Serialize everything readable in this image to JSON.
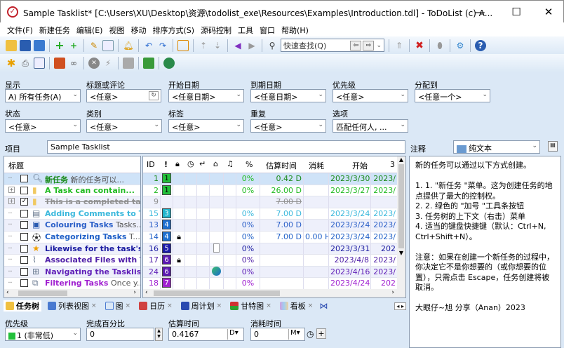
{
  "window": {
    "title": "Sample Tasklist* [C:\\Users\\XU\\Desktop\\资源\\todolist_exe\\Resources\\Examples\\Introduction.tdl] - ToDoList (c) A...",
    "minimize": "—",
    "maximize": "☐",
    "close": "✕"
  },
  "menu": [
    "文件(F)",
    "新建任务",
    "编辑(E)",
    "视图",
    "移动",
    "排序方式(S)",
    "源码控制",
    "工具",
    "窗口",
    "帮助(H)"
  ],
  "toolbar": {
    "quickfind_placeholder": "快速查找(Q)"
  },
  "filters": {
    "show": {
      "label": "显示",
      "value": "A)  所有任务(A)"
    },
    "title_comment": {
      "label": "标题或评论",
      "value": "<任意>"
    },
    "start_date": {
      "label": "开始日期",
      "value": "<任意日期>"
    },
    "due_date": {
      "label": "到期日期",
      "value": "<任意日期>"
    },
    "priority": {
      "label": "优先级",
      "value": "<任意>"
    },
    "assigned": {
      "label": "分配到",
      "value": "<任意一个>"
    },
    "status": {
      "label": "状态",
      "value": "<任意>"
    },
    "category": {
      "label": "类别",
      "value": "<任意>"
    },
    "tags": {
      "label": "标签",
      "value": "<任意>"
    },
    "recurrence": {
      "label": "重复",
      "value": "<任意>"
    },
    "options": {
      "label": "选项",
      "value": "匹配任何人, ..."
    }
  },
  "project": {
    "label": "项目",
    "value": "Sample Tasklist"
  },
  "columns": {
    "title": "标题",
    "id": "ID",
    "priority": "!",
    "percent": "%",
    "estimate": "估算时间",
    "spent": "消耗",
    "start": "开始",
    "due": "3"
  },
  "colors": {
    "selected_row": "#cfe3f8",
    "alt_row": "#eef0fb",
    "panel_bg": "#dbe8f6"
  },
  "tasks": [
    {
      "title": "新任务",
      "comment": "新的任务可以...",
      "id": "1",
      "priority": "1",
      "prio_color": "#22c03a",
      "color": "#1a8a1a",
      "icon": "search-icon",
      "percent": "0%",
      "estimate": "0.42 D",
      "spent": "",
      "start": "2023/3/30",
      "due": "2023/",
      "expand": false,
      "done": false,
      "lock": false,
      "selected": true
    },
    {
      "title": "A Task can contain...",
      "comment": "",
      "id": "2",
      "priority": "1",
      "prio_color": "#22c03a",
      "color": "#22bb22",
      "icon": "folder-icon",
      "percent": "0%",
      "estimate": "26.00 D",
      "spent": "",
      "start": "2023/3/27",
      "due": "2023/",
      "expand": true,
      "done": false
    },
    {
      "title": "This is a completed task",
      "comment": "",
      "id": "9",
      "priority": "",
      "prio_color": "",
      "color": "#909090",
      "icon": "folder-icon",
      "percent": "",
      "estimate": "7.00 D",
      "spent": "",
      "start": "",
      "due": "",
      "expand": true,
      "done": true
    },
    {
      "title": "Adding Comments to T...",
      "comment": "",
      "id": "15",
      "priority": "3",
      "prio_color": "#1fb4cc",
      "color": "#3ab8dc",
      "icon": "document-icon",
      "percent": "0%",
      "estimate": "7.00 D",
      "spent": "",
      "start": "2023/3/24",
      "due": "2023/"
    },
    {
      "title": "Colouring Tasks",
      "comment": "Tasks...",
      "id": "13",
      "priority": "4",
      "prio_color": "#1e6fd0",
      "color": "#2b5fc8",
      "icon": "monitor-icon",
      "percent": "0%",
      "estimate": "7.00 D",
      "spent": "",
      "start": "2023/3/24",
      "due": "2023/"
    },
    {
      "title": "Categorizing Tasks",
      "comment": "T...",
      "id": "14",
      "priority": "4",
      "prio_color": "#1e6fd0",
      "color": "#2060c8",
      "icon": "soccer-ball-icon",
      "percent": "0%",
      "estimate": "7.00 D",
      "spent": "0.00 H",
      "start": "2023/3/24",
      "due": "2023/",
      "lock": true
    },
    {
      "title": "Likewise for the task's ...",
      "comment": "",
      "id": "16",
      "priority": "5",
      "prio_color": "#1a1aa8",
      "color": "#1a1aa0",
      "icon": "star-icon",
      "percent": "0%",
      "estimate": "",
      "spent": "",
      "start": "2023/3/31",
      "due": "202",
      "file": "file-icon"
    },
    {
      "title": "Associated Files with T...",
      "comment": "",
      "id": "17",
      "priority": "6",
      "prio_color": "#5a18b0",
      "color": "#5020a8",
      "icon": "paperclip-icon",
      "percent": "0%",
      "estimate": "",
      "spent": "",
      "start": "2023/4/8",
      "due": "2023/",
      "lock": true
    },
    {
      "title": "Navigating the Tasklist",
      "comment": "",
      "id": "24",
      "priority": "6",
      "prio_color": "#5a18b0",
      "color": "#6020b8",
      "icon": "toolbox-icon",
      "percent": "0%",
      "estimate": "",
      "spent": "",
      "start": "2023/4/16",
      "due": "2023/",
      "file": "edge-browser-icon"
    },
    {
      "title": "Filtering Tasks",
      "comment": "Once y...",
      "id": "18",
      "priority": "7",
      "prio_color": "#a020d0",
      "color": "#a020d0",
      "icon": "filter-icon",
      "percent": "0%",
      "estimate": "",
      "spent": "",
      "start": "2023/4/24",
      "due": "202"
    }
  ],
  "tabs": [
    {
      "label": "任务树",
      "active": true
    },
    {
      "label": "列表视图"
    },
    {
      "label": "图"
    },
    {
      "label": "日历"
    },
    {
      "label": "周计划"
    },
    {
      "label": "甘特图"
    },
    {
      "label": "看板"
    }
  ],
  "details": {
    "priority": {
      "label": "优先级",
      "value": "1 (非常低)"
    },
    "percent": {
      "label": "完成百分比",
      "value": "0"
    },
    "estimate": {
      "label": "估算时间",
      "value": "0.4167",
      "unit": "D"
    },
    "spent": {
      "label": "消耗时间",
      "value": "0",
      "unit": "M"
    }
  },
  "notes": {
    "label": "注释",
    "format": "纯文本",
    "text": "新的任务可以通过以下方式创建。\n\n1. 1. \"新任务 \"菜单。这为创建任务的地点提供了最大的控制权。\n2. 2. 绿色的 \"加号 \"工具条按钮\n3. 任务树的上下文（右击）菜单\n4. 适当的键盘快捷键（默认：Ctrl+N, Ctrl+Shift+N）。\n\n注意：如果在创建一个新任务的过程中，你决定它不是你想要的（或你想要的位置），只需点击 Escape，任务创建将被取消。\n\n大眼仔~旭 分享（Anan）2023"
  }
}
